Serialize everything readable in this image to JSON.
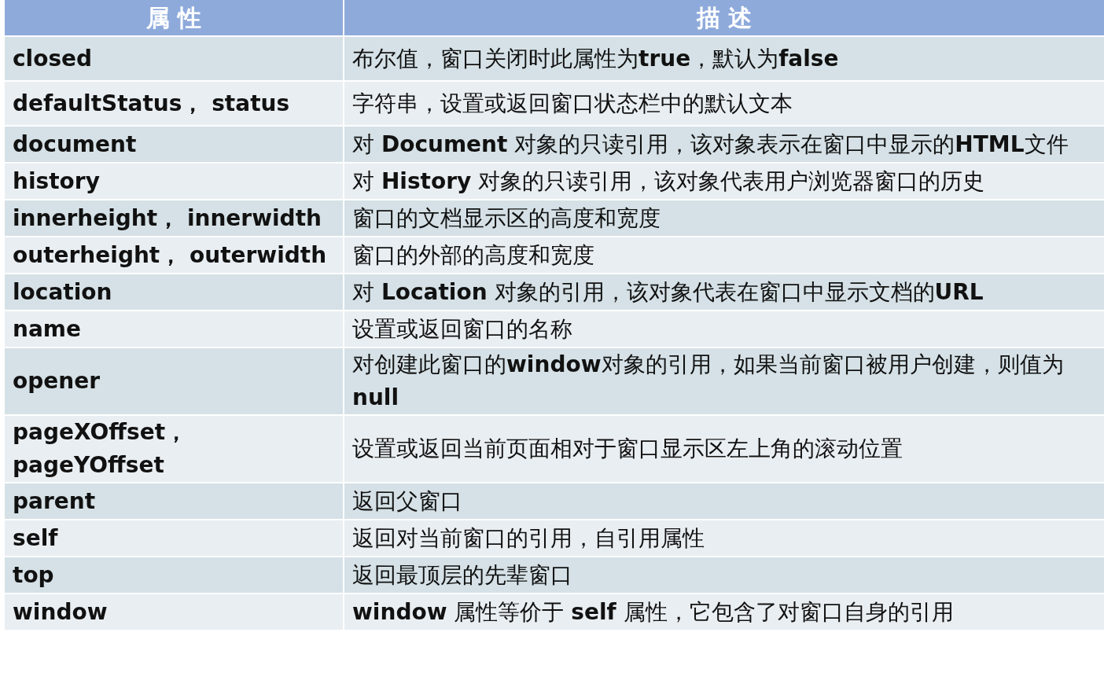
{
  "table": {
    "columns": [
      "属 性",
      "描 述"
    ],
    "rows": [
      {
        "property": "closed",
        "description": "布尔值，窗口关闭时此属性为**true**，默认为**false**"
      },
      {
        "property": "defaultStatus， status",
        "description": "字符串，设置或返回窗口状态栏中的默认文本"
      },
      {
        "property": "document",
        "description": "对 **Document** 对象的只读引用，该对象表示在窗口中显示的**HTML**文件"
      },
      {
        "property": "history",
        "description": "对 **History** 对象的只读引用，该对象代表用户浏览器窗口的历史"
      },
      {
        "property": "innerheight， innerwidth",
        "description": "窗口的文档显示区的高度和宽度"
      },
      {
        "property": "outerheight， outerwidth",
        "description": "窗口的外部的高度和宽度"
      },
      {
        "property": "location",
        "description": "对 **Location** 对象的引用，该对象代表在窗口中显示文档的**URL**"
      },
      {
        "property": "name",
        "description": "设置或返回窗口的名称"
      },
      {
        "property": "opener",
        "description": "对创建此窗口的**window**对象的引用，如果当前窗口被用户创建，则值为**null**"
      },
      {
        "property": "pageXOffset， pageYOffset",
        "description": "设置或返回当前页面相对于窗口显示区左上角的滚动位置"
      },
      {
        "property": "parent",
        "description": "返回父窗口"
      },
      {
        "property": "self",
        "description": "返回对当前窗口的引用，自引用属性"
      },
      {
        "property": "top",
        "description": "返回最顶层的先辈窗口"
      },
      {
        "property": "window",
        "description": "**window** 属性等价于 **self** 属性，它包含了对窗口自身的引用"
      }
    ]
  }
}
